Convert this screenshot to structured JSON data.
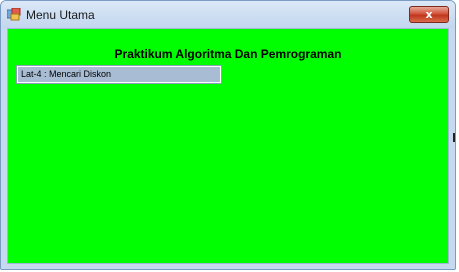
{
  "window": {
    "title": "Menu Utama",
    "close_label": "x"
  },
  "main": {
    "heading": "Praktikum Algoritma Dan Pemrograman",
    "menu_items": [
      {
        "label": "Lat-4 : Mencari  Diskon",
        "selected": true
      }
    ]
  },
  "colors": {
    "client_background": "#00ff00",
    "selected_item": "#a8bcd4",
    "close_button": "#c0371c"
  }
}
